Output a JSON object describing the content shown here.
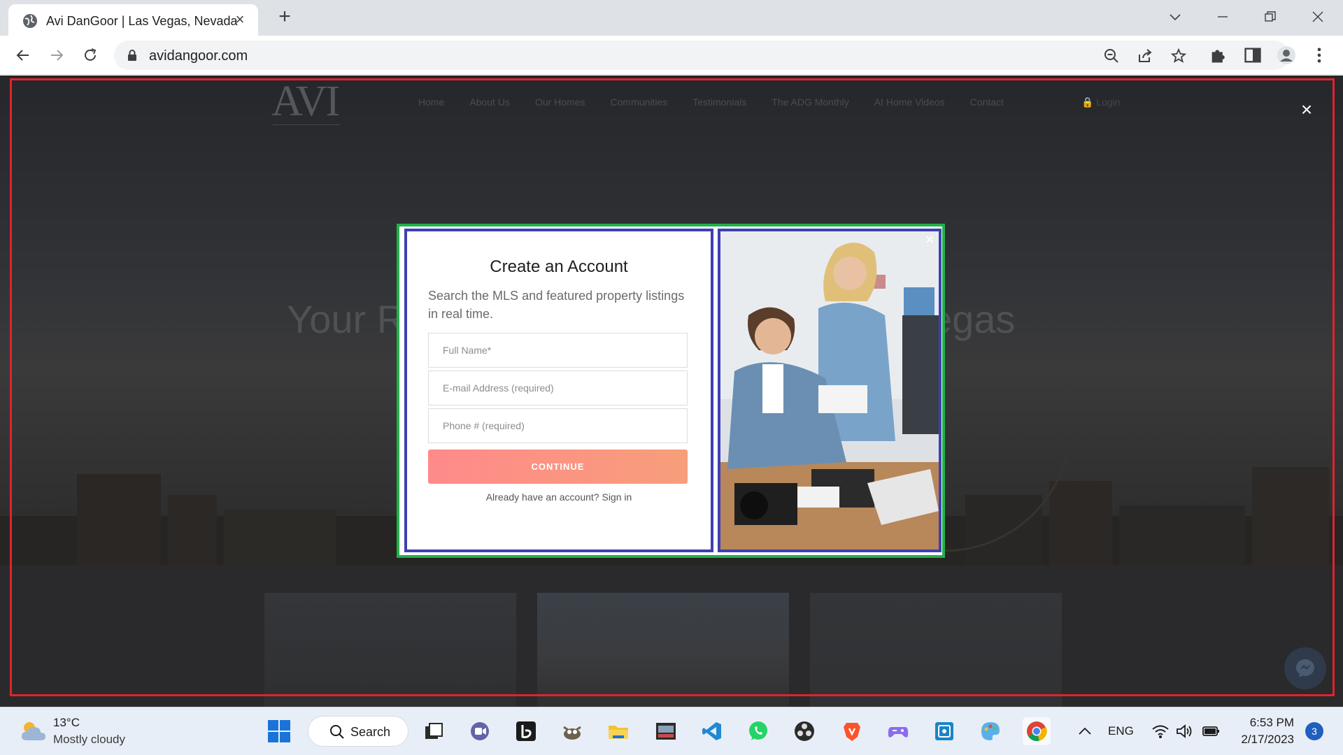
{
  "browser": {
    "tab_title": "Avi DanGoor | Las Vegas, Nevada",
    "url": "avidangoor.com",
    "icons": [
      "globe-icon",
      "close-icon",
      "plus-icon",
      "chevron-down-icon",
      "minimize-icon",
      "restore-icon",
      "close-icon",
      "back-icon",
      "forward-icon",
      "reload-icon",
      "lock-icon",
      "zoom-out-icon",
      "share-icon",
      "star-icon",
      "puzzle-icon",
      "side-panel-icon",
      "profile-icon",
      "kebab-icon"
    ]
  },
  "site": {
    "logo": "AVI",
    "nav": [
      "Home",
      "About Us",
      "Our Homes",
      "Communities",
      "Testimonials",
      "The ADG Monthly",
      "At Home Videos",
      "Contact"
    ],
    "login": "Login",
    "hero_left": "Your R",
    "hero_right": "egas"
  },
  "modal": {
    "title": "Create an Account",
    "subtitle": "Search the MLS and featured property listings in real time.",
    "fields": [
      {
        "placeholder": "Full Name*"
      },
      {
        "placeholder": "E-mail Address (required)"
      },
      {
        "placeholder": "Phone # (required)"
      }
    ],
    "continue_label": "CONTINUE",
    "signin_text": "Already have an account? Sign in"
  },
  "taskbar": {
    "weather_temp": "13°C",
    "weather_desc": "Mostly cloudy",
    "search_label": "Search",
    "language": "ENG",
    "time": "6:53 PM",
    "date": "2/17/2023",
    "notifications": "3"
  },
  "colors": {
    "annotation_outer": "#e0232b",
    "annotation_modal": "#22b04a",
    "annotation_panels": "#3f3fb4",
    "button_gradient_start": "#ff8a8a",
    "button_gradient_end": "#f79e7a"
  }
}
